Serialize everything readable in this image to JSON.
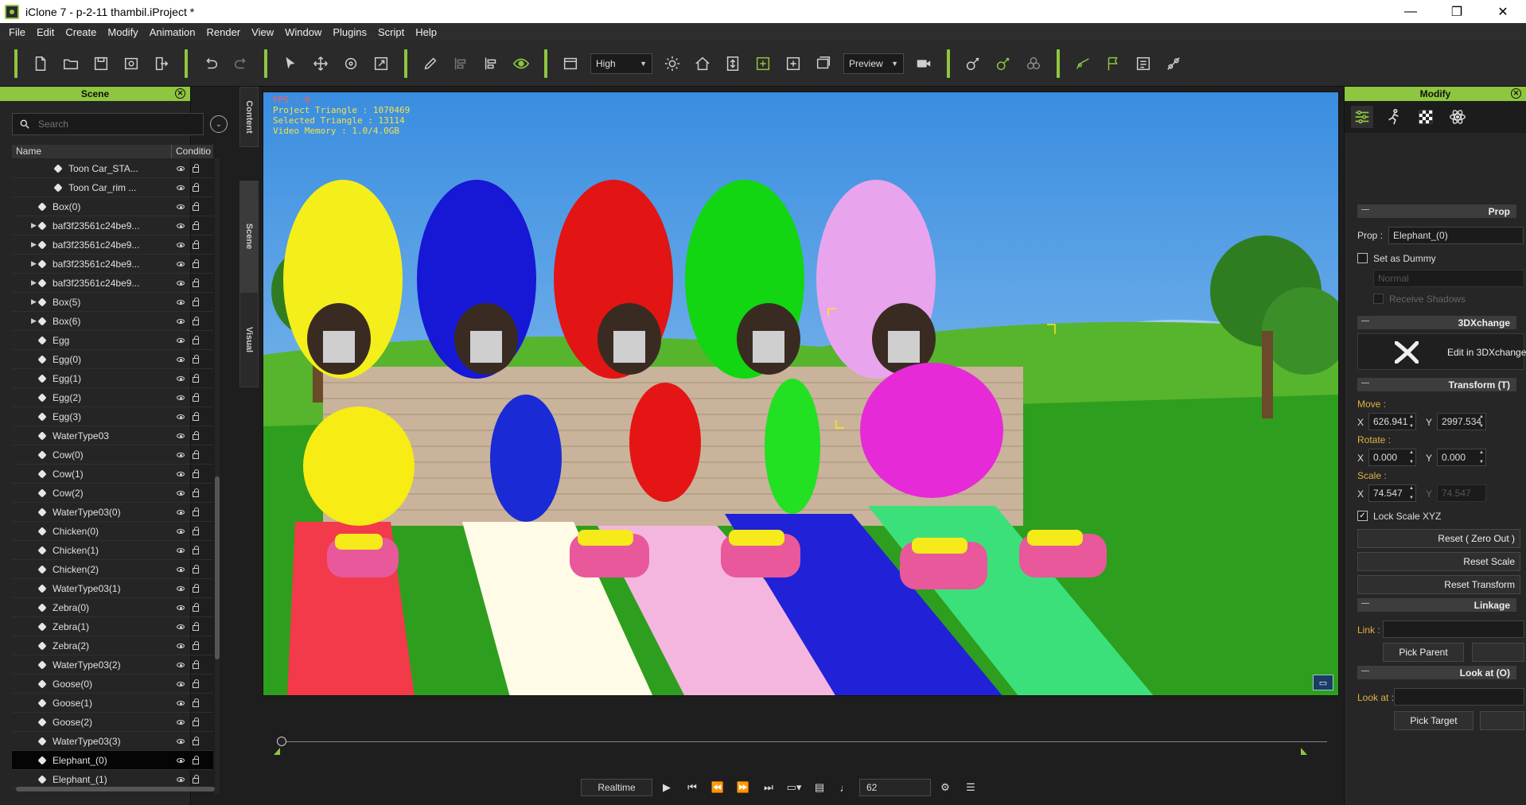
{
  "window": {
    "title": "iClone 7 - p-2-11 thambil.iProject *",
    "minimize": "—",
    "maximize": "❐",
    "close": "✕"
  },
  "menu": [
    "File",
    "Edit",
    "Create",
    "Modify",
    "Animation",
    "Render",
    "View",
    "Window",
    "Plugins",
    "Script",
    "Help"
  ],
  "toolbar": {
    "quality": "High",
    "render_mode": "Preview"
  },
  "scene_panel": {
    "title": "Scene",
    "search_placeholder": "Search",
    "col_name": "Name",
    "col_condition": "Conditio",
    "items": [
      {
        "label": "Toon Car_STA...",
        "indent": 3,
        "expand": false
      },
      {
        "label": "Toon Car_rim ...",
        "indent": 3,
        "expand": false
      },
      {
        "label": "Box(0)",
        "indent": 2,
        "expand": false
      },
      {
        "label": "baf3f23561c24be9...",
        "indent": 2,
        "expand": true
      },
      {
        "label": "baf3f23561c24be9...",
        "indent": 2,
        "expand": true
      },
      {
        "label": "baf3f23561c24be9...",
        "indent": 2,
        "expand": true
      },
      {
        "label": "baf3f23561c24be9...",
        "indent": 2,
        "expand": true
      },
      {
        "label": "Box(5)",
        "indent": 2,
        "expand": true
      },
      {
        "label": "Box(6)",
        "indent": 2,
        "expand": true
      },
      {
        "label": "Egg",
        "indent": 2,
        "expand": false
      },
      {
        "label": "Egg(0)",
        "indent": 2,
        "expand": false
      },
      {
        "label": "Egg(1)",
        "indent": 2,
        "expand": false
      },
      {
        "label": "Egg(2)",
        "indent": 2,
        "expand": false
      },
      {
        "label": "Egg(3)",
        "indent": 2,
        "expand": false
      },
      {
        "label": "WaterType03",
        "indent": 2,
        "expand": false
      },
      {
        "label": "Cow(0)",
        "indent": 2,
        "expand": false
      },
      {
        "label": "Cow(1)",
        "indent": 2,
        "expand": false
      },
      {
        "label": "Cow(2)",
        "indent": 2,
        "expand": false
      },
      {
        "label": "WaterType03(0)",
        "indent": 2,
        "expand": false
      },
      {
        "label": "Chicken(0)",
        "indent": 2,
        "expand": false
      },
      {
        "label": "Chicken(1)",
        "indent": 2,
        "expand": false
      },
      {
        "label": "Chicken(2)",
        "indent": 2,
        "expand": false
      },
      {
        "label": "WaterType03(1)",
        "indent": 2,
        "expand": false
      },
      {
        "label": "Zebra(0)",
        "indent": 2,
        "expand": false
      },
      {
        "label": "Zebra(1)",
        "indent": 2,
        "expand": false
      },
      {
        "label": "Zebra(2)",
        "indent": 2,
        "expand": false
      },
      {
        "label": "WaterType03(2)",
        "indent": 2,
        "expand": false
      },
      {
        "label": "Goose(0)",
        "indent": 2,
        "expand": false
      },
      {
        "label": "Goose(1)",
        "indent": 2,
        "expand": false
      },
      {
        "label": "Goose(2)",
        "indent": 2,
        "expand": false
      },
      {
        "label": "WaterType03(3)",
        "indent": 2,
        "expand": false
      },
      {
        "label": "Elephant_(0)",
        "indent": 2,
        "expand": false,
        "selected": true
      },
      {
        "label": "Elephant_(1)",
        "indent": 2,
        "expand": false
      }
    ]
  },
  "side_tabs": {
    "content": "Content",
    "scene": "Scene",
    "visual": "Visual"
  },
  "viewport": {
    "fps": "FPS : 0.",
    "project_triangle": "Project Triangle : 1070469",
    "selected_triangle": "Selected Triangle : 13114",
    "video_memory": "Video Memory : 1.0/4.0GB"
  },
  "playback": {
    "mode": "Realtime",
    "frame": "62"
  },
  "modify_panel": {
    "title": "Modify",
    "sections": {
      "prop": "Prop",
      "dxchange": "3DXchange",
      "transform": "Transform  (T)",
      "linkage": "Linkage",
      "look_at": "Look at  (O)"
    },
    "prop_label": "Prop :",
    "prop_value": "Elephant_(0)",
    "set_as_dummy": "Set as Dummy",
    "normal": "Normal",
    "receive_shadows": "Receive Shadows",
    "edit_in_3dx": "Edit in 3DXchange",
    "move_label": "Move :",
    "rotate_label": "Rotate :",
    "scale_label": "Scale :",
    "x": "X",
    "y": "Y",
    "move_x": "626.941",
    "move_y": "2997.534",
    "rotate_x": "0.000",
    "rotate_y": "0.000",
    "scale_x": "74.547",
    "scale_y": "74.547",
    "lock_scale": "Lock Scale XYZ",
    "reset_zero": "Reset ( Zero Out )",
    "reset_scale": "Reset Scale",
    "reset_transform": "Reset Transform",
    "link_label": "Link :",
    "pick_parent": "Pick Parent",
    "look_at_label": "Look at :",
    "pick_target": "Pick Target"
  },
  "colors": {
    "accent": "#8ec63f",
    "selection": "#050505",
    "stats_text": "#f2e24a",
    "fps_text": "#ff5c5c"
  }
}
